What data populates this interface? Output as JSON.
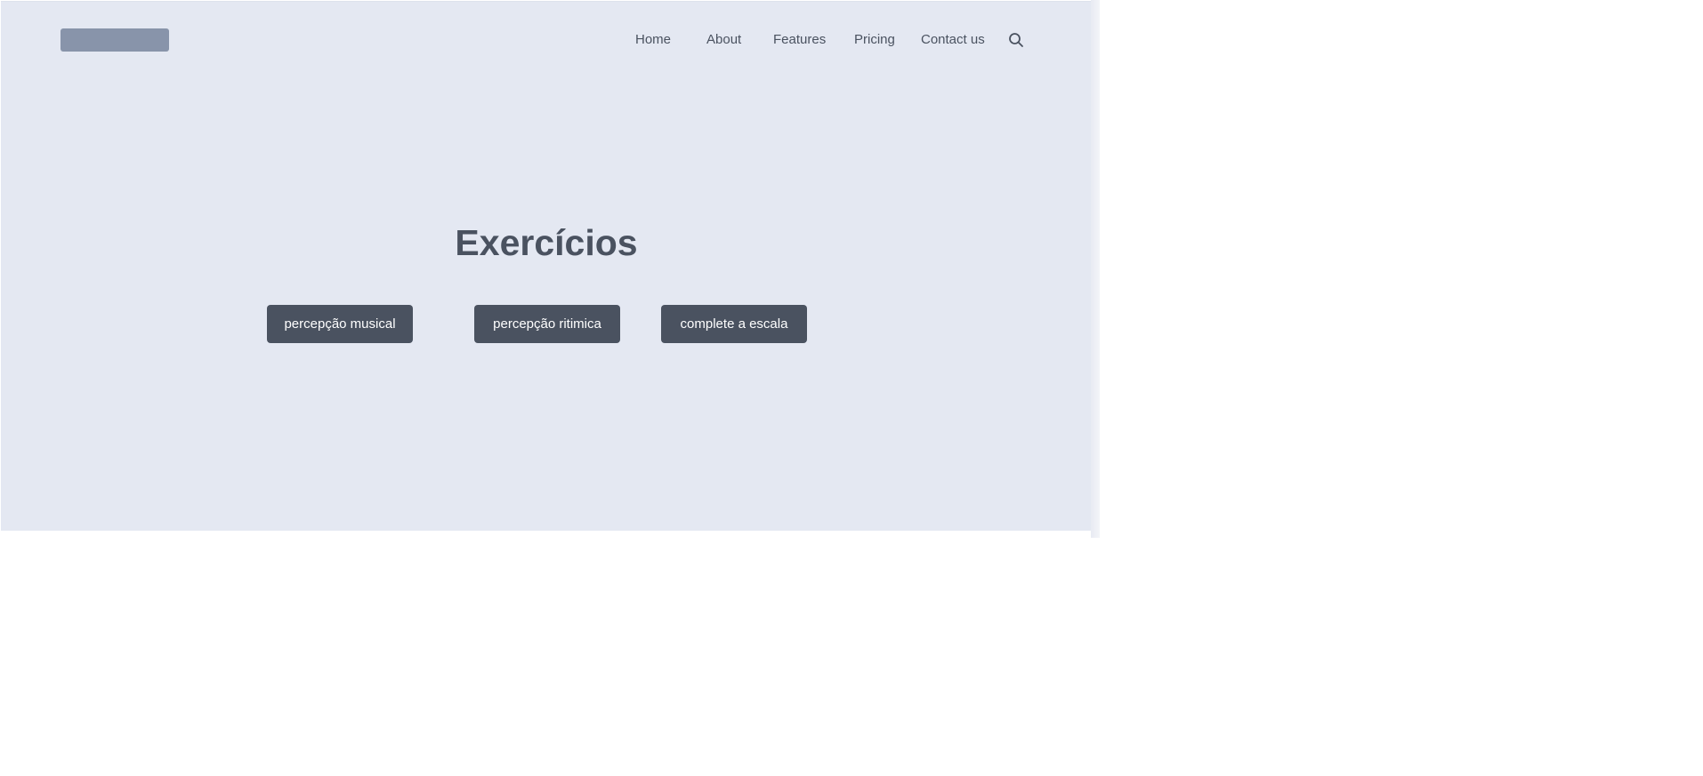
{
  "header": {
    "nav": [
      {
        "label": "Home"
      },
      {
        "label": "About"
      },
      {
        "label": "Features"
      },
      {
        "label": "Pricing"
      },
      {
        "label": "Contact us"
      }
    ],
    "search_icon": "search-icon"
  },
  "hero": {
    "title": "Exercícios",
    "buttons": [
      {
        "label": "percepção musical"
      },
      {
        "label": "percepção ritimica"
      },
      {
        "label": "complete a escala"
      }
    ]
  },
  "colors": {
    "hero_background": "#e4e8f2",
    "text": "#4a5260",
    "button_background": "#4a5260",
    "logo_placeholder": "#8894aa"
  }
}
